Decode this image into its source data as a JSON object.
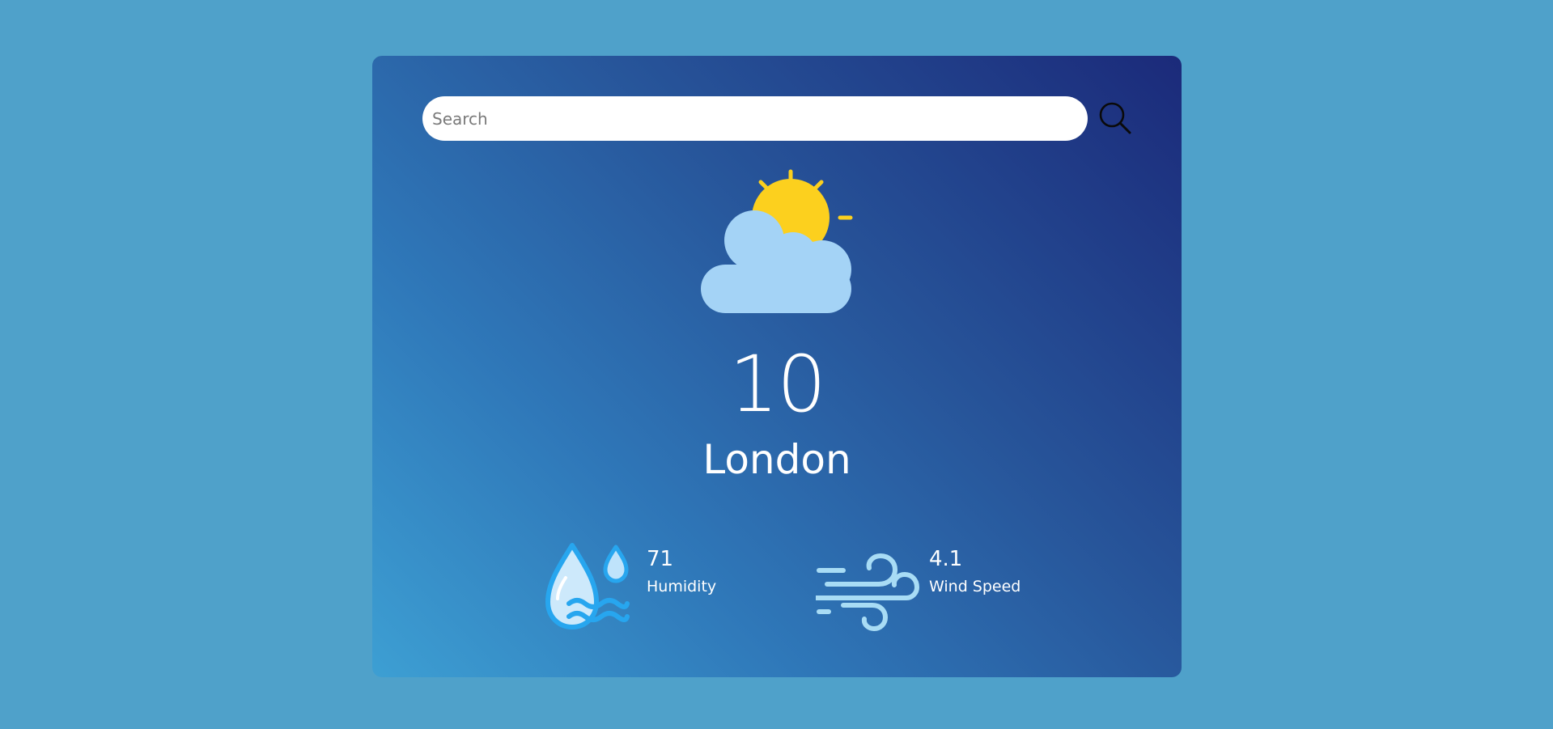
{
  "search": {
    "placeholder": "Search",
    "value": "",
    "icon": "search-icon"
  },
  "weather": {
    "icon": "partly-cloudy-icon",
    "temperature": "10",
    "city": "London"
  },
  "stats": {
    "humidity": {
      "value": "71",
      "label": "Humidity",
      "icon": "humidity-icon"
    },
    "wind": {
      "value": "4.1",
      "label": "Wind Speed",
      "icon": "wind-icon"
    }
  },
  "colors": {
    "page_background": "#4fa1ca",
    "card_gradient_start": "#3d9fd3",
    "card_gradient_end": "#1b2a7a",
    "sun": "#fcd01e",
    "cloud": "#a4d3f6",
    "text": "#ffffff"
  }
}
